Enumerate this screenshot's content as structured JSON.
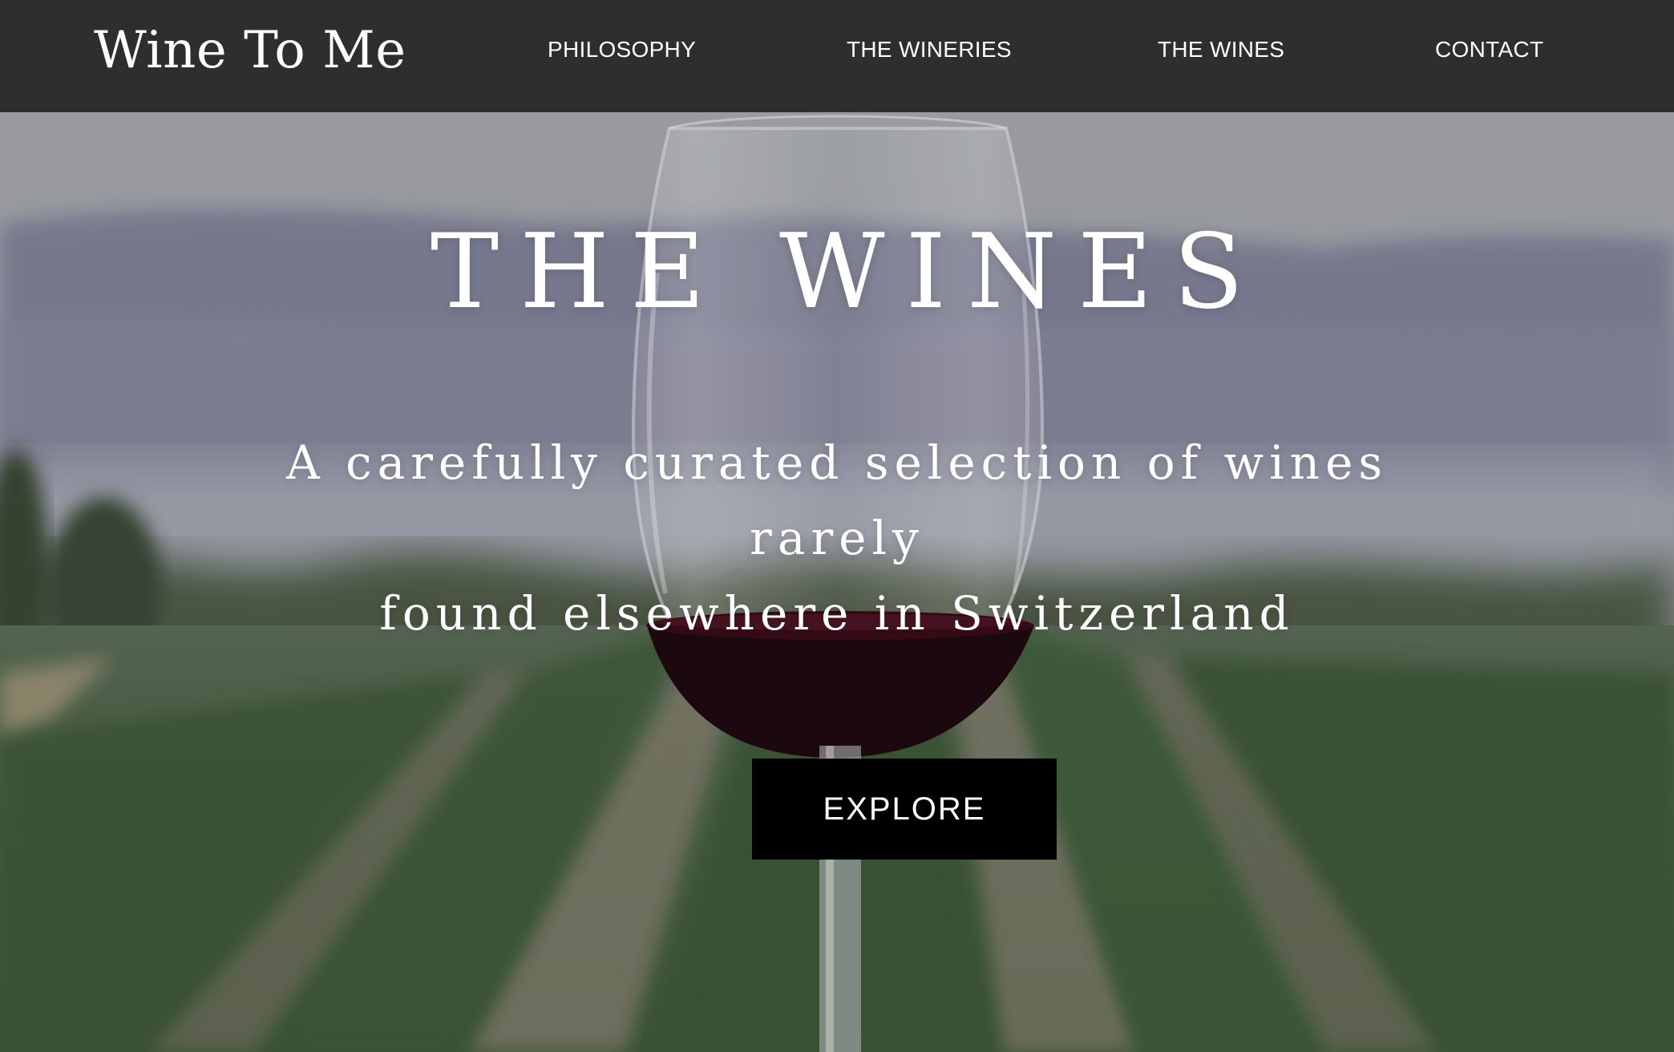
{
  "header": {
    "logo": "Wine To Me",
    "nav": [
      {
        "label": "PHILOSOPHY"
      },
      {
        "label": "THE WINERIES"
      },
      {
        "label": "THE WINES"
      },
      {
        "label": "CONTACT"
      }
    ]
  },
  "hero": {
    "title": "THE WINES",
    "subtitle_line1": "A carefully curated selection of wines rarely",
    "subtitle_line2": "found elsewhere in Switzerland",
    "button_label": "EXPLORE"
  },
  "colors": {
    "header_bg": "#2e2e30",
    "button_bg": "#000000",
    "text": "#ffffff",
    "wine": "#3a0d18"
  },
  "background_image": "wine glass held in front of a blurred vineyard with mountains"
}
